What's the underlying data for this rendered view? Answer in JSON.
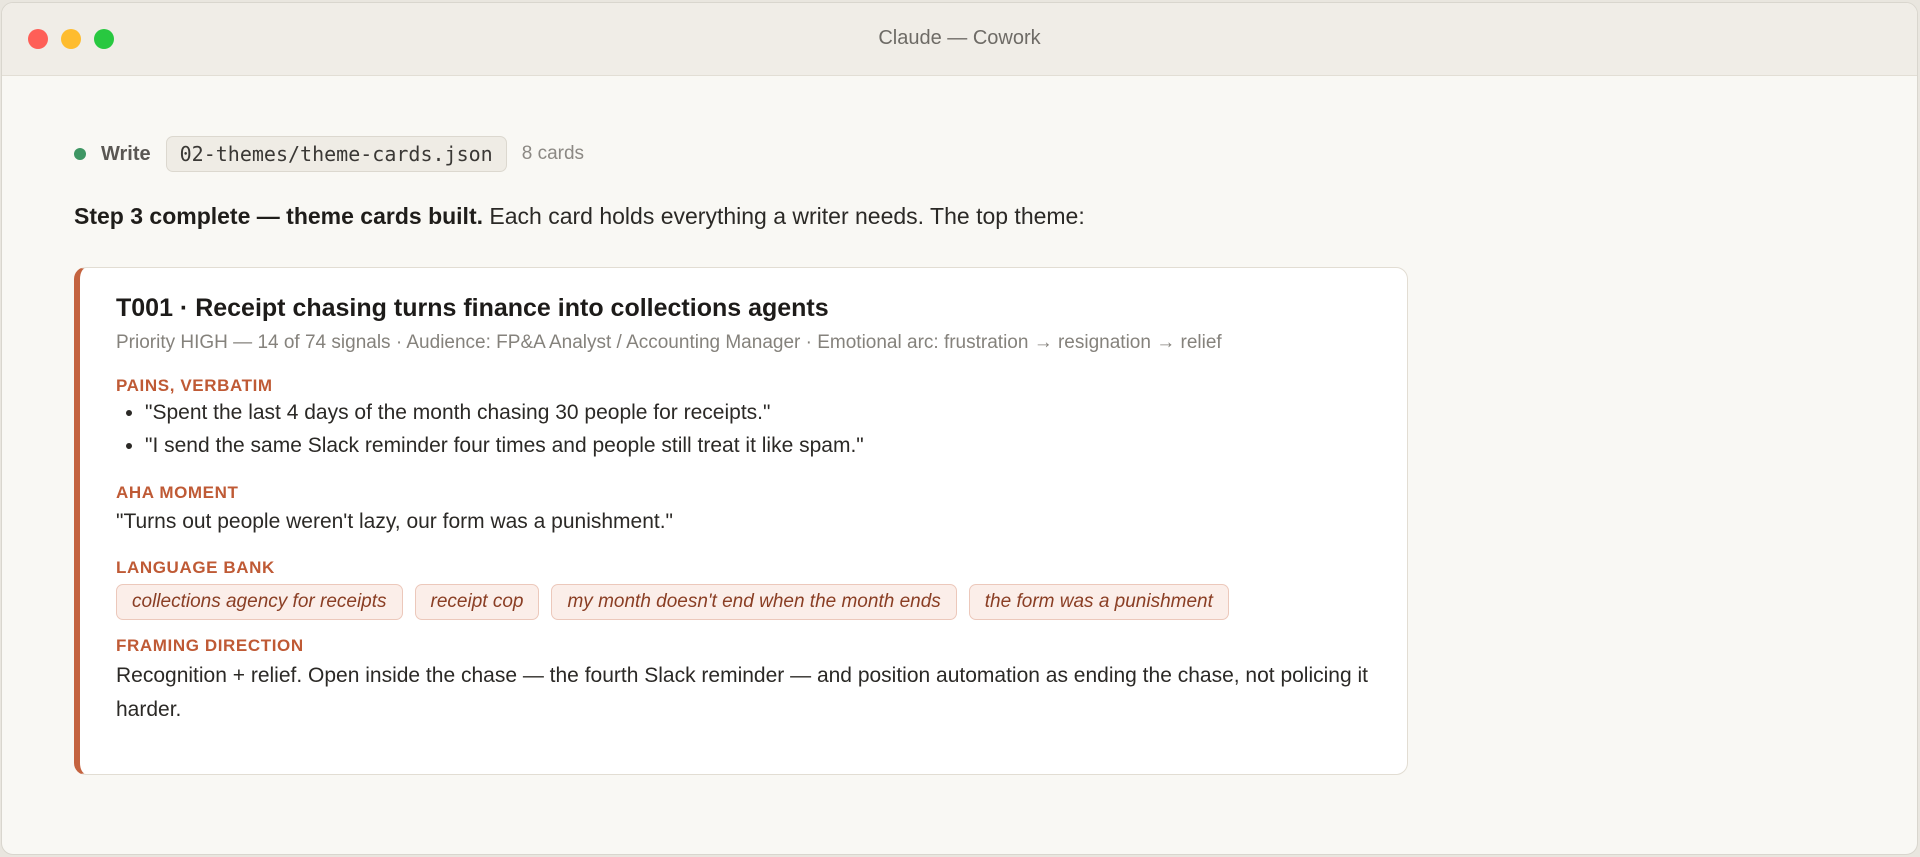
{
  "window": {
    "title": "Claude — Cowork"
  },
  "tool_call": {
    "action": "Write",
    "path": "02-themes/theme-cards.json",
    "meta": "8 cards",
    "status_color": "#3e9663"
  },
  "intro": {
    "bold": "Step 3 complete — theme cards built.",
    "rest": " Each card holds everything a writer needs. The top theme:"
  },
  "card": {
    "title": "T001 · Receipt chasing turns finance into collections agents",
    "meta": "Priority HIGH — 14 of 74 signals · Audience: FP&A Analyst / Accounting Manager · Emotional arc: frustration → resignation → relief",
    "accent_color": "#c4633f",
    "pains_label": "PAINS, VERBATIM",
    "pains": [
      "\"Spent the last 4 days of the month chasing 30 people for receipts.\"",
      "\"I send the same Slack reminder four times and people still treat it like spam.\""
    ],
    "aha_label": "AHA MOMENT",
    "aha": "\"Turns out people weren't lazy, our form was a punishment.\"",
    "language_label": "LANGUAGE BANK",
    "language_bank": [
      "collections agency for receipts",
      "receipt cop",
      "my month doesn't end when the month ends",
      "the form was a punishment"
    ],
    "framing_label": "FRAMING DIRECTION",
    "framing": "Recognition + relief. Open inside the chase — the fourth Slack reminder — and position automation as ending the chase, not policing it harder."
  }
}
